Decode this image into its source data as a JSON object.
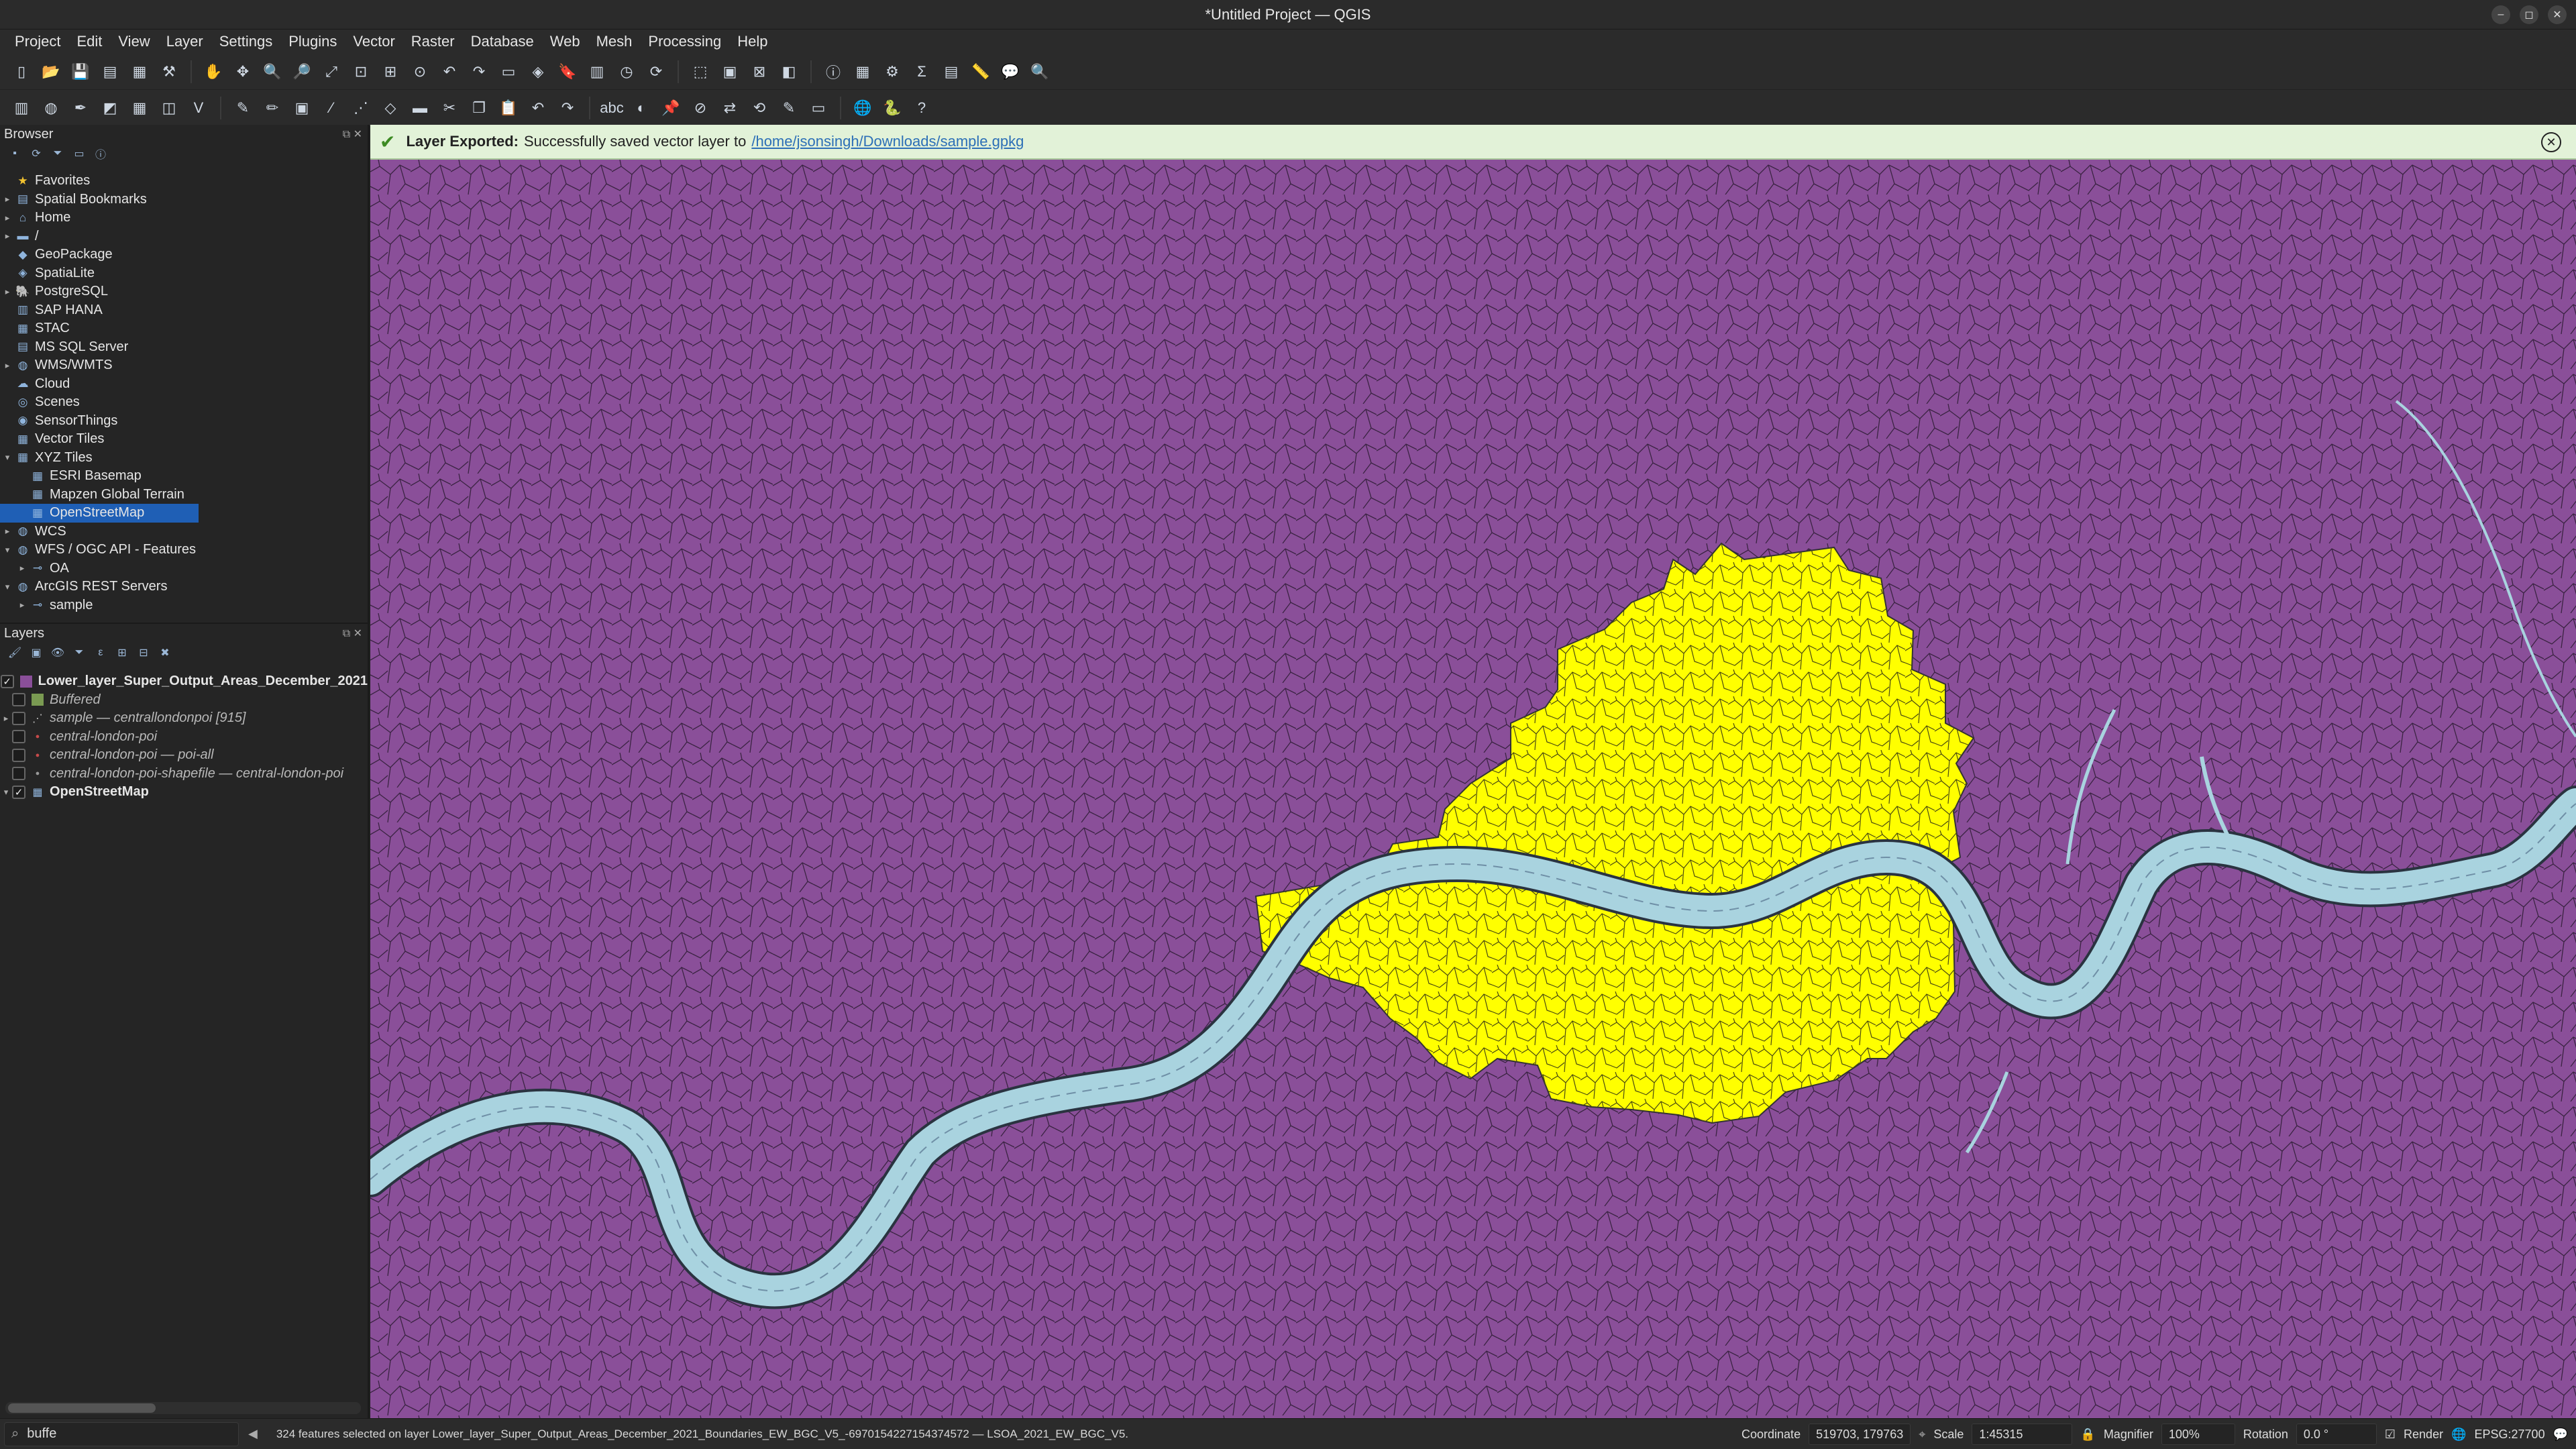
{
  "window": {
    "title": "*Untitled Project — QGIS"
  },
  "menu": [
    "Project",
    "Edit",
    "View",
    "Layer",
    "Settings",
    "Plugins",
    "Vector",
    "Raster",
    "Database",
    "Web",
    "Mesh",
    "Processing",
    "Help"
  ],
  "browser": {
    "title": "Browser",
    "items": [
      {
        "label": "Favorites",
        "icon": "star-icon",
        "arrow": "",
        "level": 0
      },
      {
        "label": "Spatial Bookmarks",
        "icon": "bookmark-icon",
        "arrow": "▸",
        "level": 0
      },
      {
        "label": "Home",
        "icon": "home-folder-icon",
        "arrow": "▸",
        "level": 0
      },
      {
        "label": "/",
        "icon": "folder-icon",
        "arrow": "▸",
        "level": 0
      },
      {
        "label": "GeoPackage",
        "icon": "geopackage-icon",
        "arrow": "",
        "level": 0
      },
      {
        "label": "SpatiaLite",
        "icon": "spatialite-icon",
        "arrow": "",
        "level": 0
      },
      {
        "label": "PostgreSQL",
        "icon": "postgresql-icon",
        "arrow": "▸",
        "level": 0
      },
      {
        "label": "SAP HANA",
        "icon": "database-icon",
        "arrow": "",
        "level": 0
      },
      {
        "label": "STAC",
        "icon": "stac-icon",
        "arrow": "",
        "level": 0
      },
      {
        "label": "MS SQL Server",
        "icon": "mssql-icon",
        "arrow": "",
        "level": 0
      },
      {
        "label": "WMS/WMTS",
        "icon": "wms-icon",
        "arrow": "▸",
        "level": 0
      },
      {
        "label": "Cloud",
        "icon": "cloud-icon",
        "arrow": "",
        "level": 0
      },
      {
        "label": "Scenes",
        "icon": "scenes-icon",
        "arrow": "",
        "level": 0
      },
      {
        "label": "SensorThings",
        "icon": "sensor-icon",
        "arrow": "",
        "level": 0
      },
      {
        "label": "Vector Tiles",
        "icon": "vector-tiles-icon",
        "arrow": "",
        "level": 0
      },
      {
        "label": "XYZ Tiles",
        "icon": "xyz-tiles-icon",
        "arrow": "▾",
        "level": 0
      },
      {
        "label": "ESRI Basemap",
        "icon": "tile-icon",
        "arrow": "",
        "level": 1
      },
      {
        "label": "Mapzen Global Terrain",
        "icon": "tile-icon",
        "arrow": "",
        "level": 1
      },
      {
        "label": "OpenStreetMap",
        "icon": "tile-icon",
        "arrow": "",
        "level": 1,
        "selected": true
      },
      {
        "label": "WCS",
        "icon": "wcs-icon",
        "arrow": "▸",
        "level": 0
      },
      {
        "label": "WFS / OGC API - Features",
        "icon": "wfs-icon",
        "arrow": "▾",
        "level": 0
      },
      {
        "label": "OA",
        "icon": "wfs-connection-icon",
        "arrow": "▸",
        "level": 1
      },
      {
        "label": "ArcGIS REST Servers",
        "icon": "arcgis-icon",
        "arrow": "▾",
        "level": 0
      },
      {
        "label": "sample",
        "icon": "arcgis-connection-icon",
        "arrow": "▸",
        "level": 1
      }
    ]
  },
  "layers": {
    "title": "Layers",
    "items": [
      {
        "label": "Lower_layer_Super_Output_Areas_December_2021",
        "checked": true,
        "style": "bold",
        "symbol": "purple-fill-symbol",
        "color": "#8a4f99"
      },
      {
        "label": "Buffered",
        "checked": false,
        "style": "ital",
        "symbol": "green-fill-symbol",
        "color": "#7a9a52"
      },
      {
        "label": "sample — centrallondonpoi [915]",
        "checked": false,
        "style": "ital",
        "symbol": "group-icon",
        "color": ""
      },
      {
        "label": "central-london-poi",
        "checked": false,
        "style": "ital",
        "symbol": "point-symbol",
        "color": "#c84a4a"
      },
      {
        "label": "central-london-poi — poi-all",
        "checked": false,
        "style": "ital",
        "symbol": "point-symbol",
        "color": "#c84a4a"
      },
      {
        "label": "central-london-poi-shapefile — central-london-poi",
        "checked": false,
        "style": "ital",
        "symbol": "point-symbol",
        "color": "#999999"
      },
      {
        "label": "OpenStreetMap",
        "checked": true,
        "style": "bold",
        "symbol": "xyz-tiles-icon",
        "color": ""
      }
    ]
  },
  "message": {
    "bold": "Layer Exported:",
    "text": "Successfully saved vector layer to",
    "link": "/home/jsonsingh/Downloads/sample.gpkg"
  },
  "map": {
    "background": "#8a4f99",
    "selection": "#ffff00",
    "river": "#a9d3df"
  },
  "status": {
    "locator_value": "buffe",
    "selection_message": "324 features selected on layer Lower_layer_Super_Output_Areas_December_2021_Boundaries_EW_BGC_V5_-6970154227154374572 — LSOA_2021_EW_BGC_V5.",
    "coordinate_label": "Coordinate",
    "coordinate_value": "519703, 179763",
    "scale_label": "Scale",
    "scale_value": "1:45315",
    "magnifier_label": "Magnifier",
    "magnifier_value": "100%",
    "rotation_label": "Rotation",
    "rotation_value": "0.0 °",
    "render_label": "Render",
    "crs": "EPSG:27700"
  }
}
